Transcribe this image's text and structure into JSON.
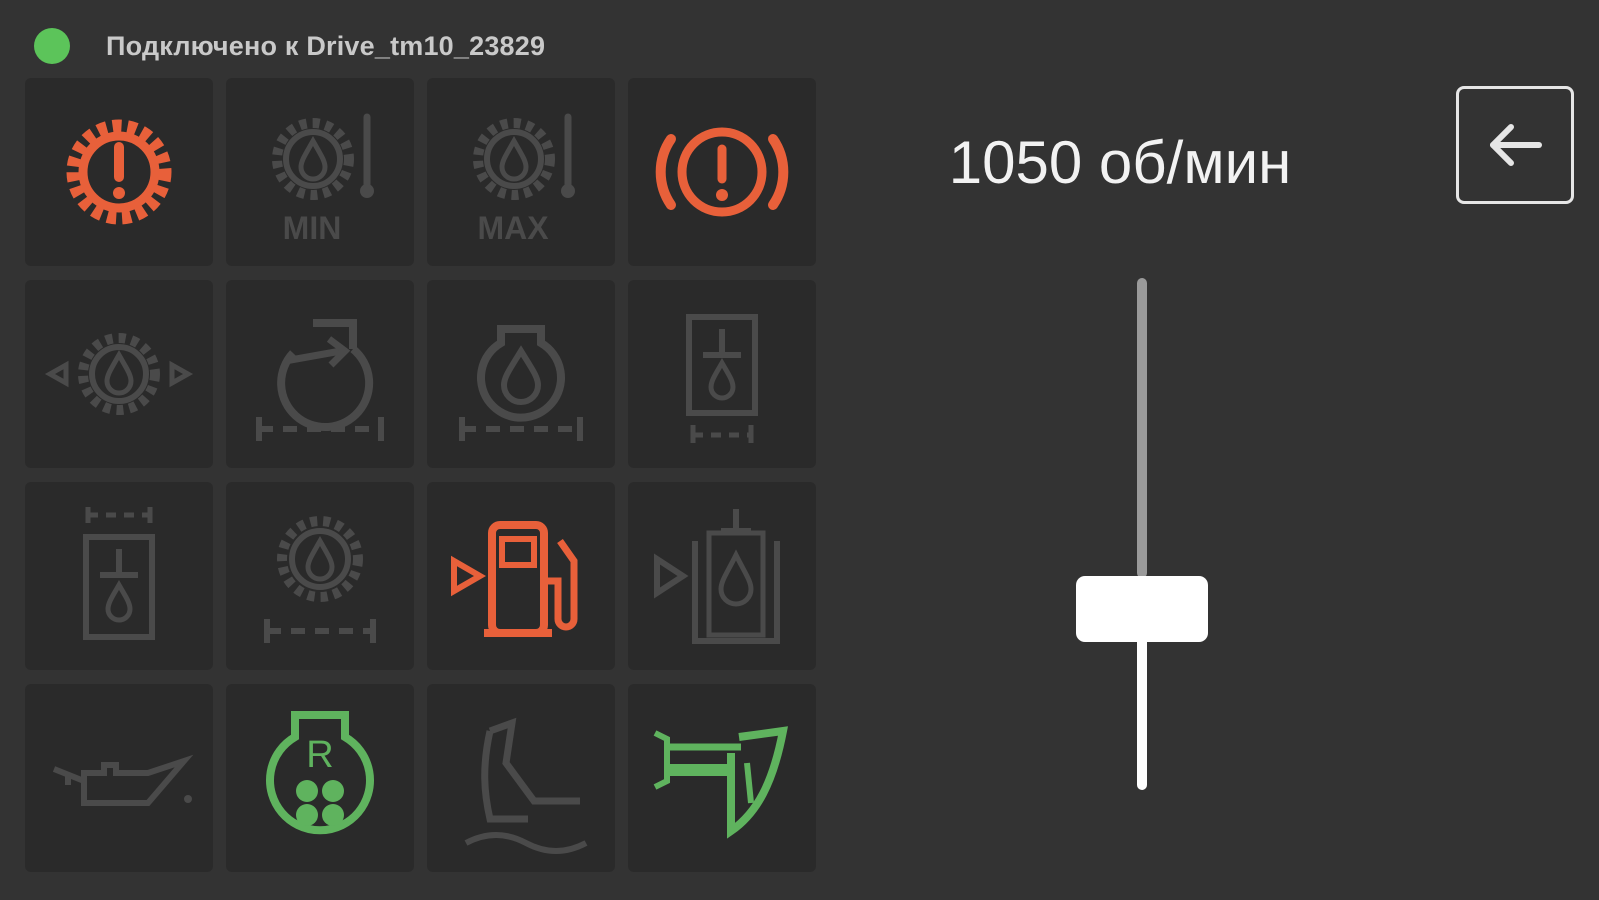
{
  "status": {
    "text": "Подключено к Drive_tm10_23829",
    "indicator_color": "#5cc45a"
  },
  "rpm_display": "1050 об/мин",
  "back_button": {
    "icon": "arrow-left-icon"
  },
  "rpm_slider": {
    "value_fraction": 0.36
  },
  "indicators": [
    {
      "icon": "transmission-warning-gear-icon",
      "state": "red"
    },
    {
      "icon": "transmission-oil-temp-min-icon",
      "state": "gray",
      "label": "MIN"
    },
    {
      "icon": "transmission-oil-temp-max-icon",
      "state": "gray",
      "label": "MAX"
    },
    {
      "icon": "brake-warning-icon",
      "state": "red"
    },
    {
      "icon": "transmission-oil-pressure-icon",
      "state": "gray"
    },
    {
      "icon": "engine-air-intake-icon",
      "state": "gray"
    },
    {
      "icon": "engine-oil-icon",
      "state": "gray"
    },
    {
      "icon": "hydraulic-oil-filter-icon",
      "state": "gray"
    },
    {
      "icon": "hydraulic-oil-level-icon",
      "state": "gray"
    },
    {
      "icon": "transmission-oil-level-icon",
      "state": "gray"
    },
    {
      "icon": "fuel-pump-icon",
      "state": "red"
    },
    {
      "icon": "hydraulic-oil-pressure-icon",
      "state": "gray"
    },
    {
      "icon": "oil-can-icon",
      "state": "gray"
    },
    {
      "icon": "fan-reverse-icon",
      "state": "green",
      "label": "R"
    },
    {
      "icon": "blade-float-icon",
      "state": "gray"
    },
    {
      "icon": "ripper-icon",
      "state": "green"
    }
  ],
  "colors": {
    "red": "#e8603a",
    "gray": "#4a4a4a",
    "green": "#5fb35e",
    "background": "#333333",
    "tile": "#2a2a2a"
  }
}
